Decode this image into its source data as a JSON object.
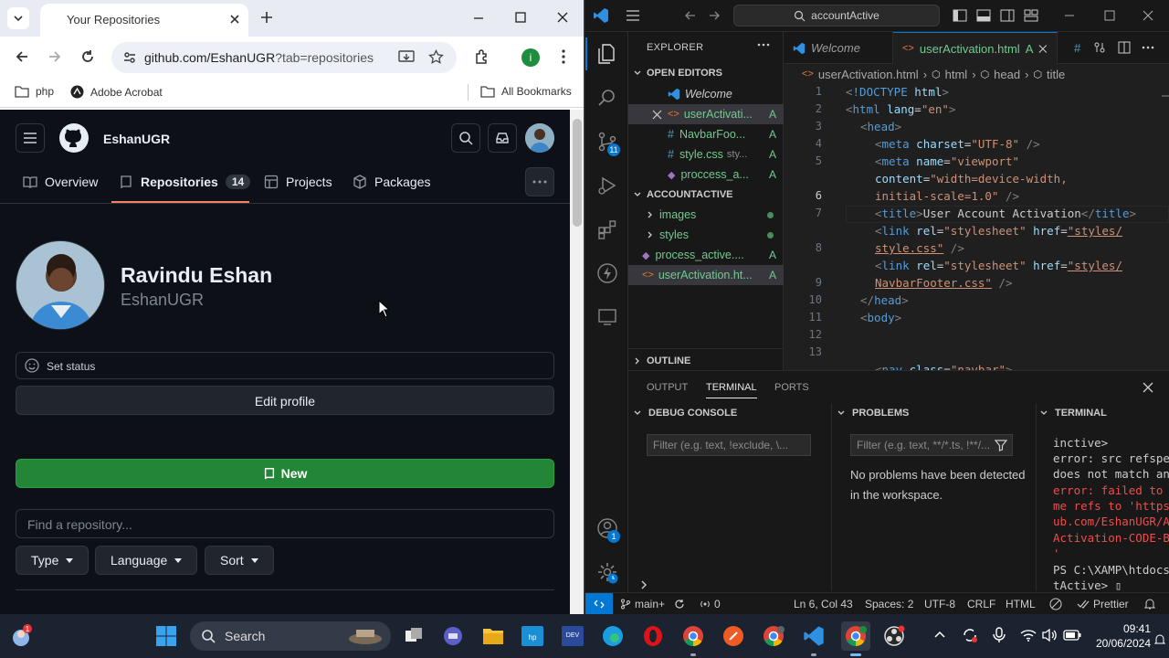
{
  "chrome": {
    "tab_title": "Your Repositories",
    "url_host": "github.com/EshanUGR",
    "url_query": "?tab=repositories",
    "profile_initial": "i",
    "bookmarks": [
      "php",
      "Adobe Acrobat"
    ],
    "all_bookmarks": "All Bookmarks"
  },
  "github": {
    "header_user": "EshanUGR",
    "nav": {
      "overview": "Overview",
      "repositories": "Repositories",
      "repo_count": "14",
      "projects": "Projects",
      "packages": "Packages"
    },
    "profile": {
      "full_name": "Ravindu Eshan",
      "username": "EshanUGR"
    },
    "set_status": "Set status",
    "edit_profile": "Edit profile",
    "new_button": "New",
    "find_placeholder": "Find a repository...",
    "filters": [
      "Type",
      "Language",
      "Sort"
    ]
  },
  "vscode": {
    "command_center": "accountActive",
    "explorer_title": "EXPLORER",
    "open_editors_label": "OPEN EDITORS",
    "open_editors": [
      {
        "name": "Welcome",
        "status": ""
      },
      {
        "name": "userActivati...",
        "status": "A"
      },
      {
        "name": "NavbarFoo...",
        "status": "A"
      },
      {
        "name": "style.css",
        "hint": "sty...",
        "status": "A"
      },
      {
        "name": "proccess_a...",
        "status": "A"
      }
    ],
    "folder_label": "ACCOUNTACTIVE",
    "folder_items": [
      {
        "name": "images",
        "kind": "folder"
      },
      {
        "name": "styles",
        "kind": "folder"
      },
      {
        "name": "process_active....",
        "status": "A"
      },
      {
        "name": "userActivation.ht...",
        "status": "A"
      }
    ],
    "outline_label": "OUTLINE",
    "tabs": [
      {
        "label": "Welcome"
      },
      {
        "label": "userActivation.html",
        "status": "A"
      }
    ],
    "breadcrumbs": [
      "userActivation.html",
      "html",
      "head",
      "title"
    ],
    "line_numbers": [
      "1",
      "2",
      "3",
      "4",
      "5",
      "",
      "6",
      "7",
      "",
      "8",
      "",
      "9",
      "10",
      "11",
      "12",
      "13"
    ],
    "panel": {
      "tabs": [
        "OUTPUT",
        "TERMINAL",
        "PORTS"
      ],
      "debug_console": "DEBUG CONSOLE",
      "problems": "PROBLEMS",
      "terminal": "TERMINAL",
      "debug_filter": "Filter (e.g. text, !exclude, \\...",
      "problems_filter": "Filter (e.g. text, **/*.ts, !**/...",
      "no_problems": "No problems have been detected in the workspace.",
      "terminal_lines": [
        {
          "text": "inctive>",
          "err": false
        },
        {
          "text": "error: src refspe",
          "err": false
        },
        {
          "text": "does not match an",
          "err": false
        },
        {
          "text": "error: failed to",
          "err": true
        },
        {
          "text": "me refs to 'https",
          "err": true
        },
        {
          "text": "ub.com/EshanUGR/A",
          "err": true
        },
        {
          "text": "Activation-CODE-B",
          "err": true
        },
        {
          "text": "'",
          "err": true
        },
        {
          "text": "PS C:\\XAMP\\htdocs",
          "err": false
        },
        {
          "text": "tActive> ▯",
          "err": false
        }
      ]
    },
    "status": {
      "branch": "main+",
      "problems": "0",
      "position": "Ln 6, Col 43",
      "spaces": "Spaces: 2",
      "encoding": "UTF-8",
      "eol": "CRLF",
      "language": "HTML",
      "prettier": "Prettier"
    }
  },
  "taskbar": {
    "search": "Search",
    "time": "09:41",
    "date": "20/06/2024"
  }
}
